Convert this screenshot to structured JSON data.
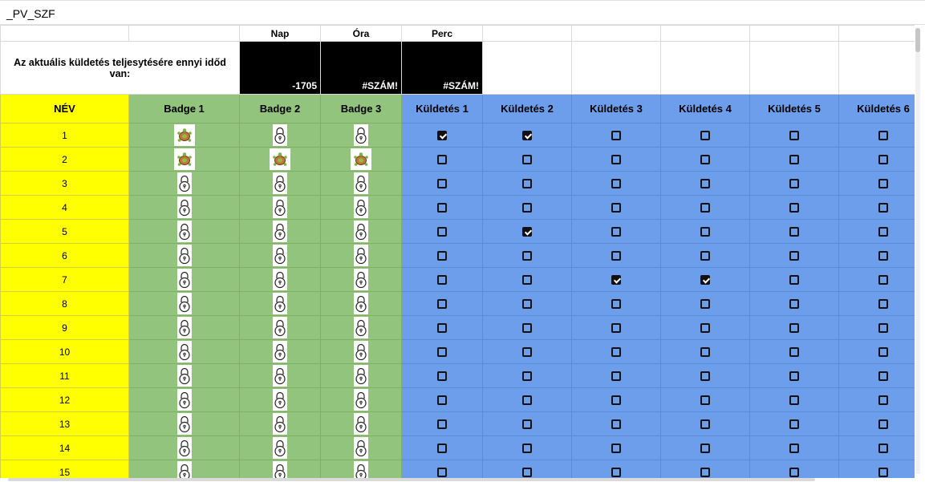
{
  "sheet": {
    "title": "_PV_SZF"
  },
  "time_header": {
    "labels": [
      "Nap",
      "Óra",
      "Perc"
    ]
  },
  "info": {
    "prompt": "Az aktuális küldetés teljesytésére ennyi időd van:",
    "values": [
      "-1705",
      "#SZÁM!",
      "#SZÁM!"
    ]
  },
  "columns": {
    "name": "NÉV",
    "badges": [
      "Badge 1",
      "Badge 2",
      "Badge 3"
    ],
    "missions": [
      "Küldetés 1",
      "Küldetés 2",
      "Küldetés 3",
      "Küldetés 4",
      "Küldetés 5",
      "Küldetés 6"
    ]
  },
  "colors": {
    "name_bg": "#ffff00",
    "badge_bg": "#93c47d",
    "mission_bg": "#6d9eeb",
    "time_bg": "#000000"
  },
  "icons": {
    "earned_badge": "turtle-icon",
    "locked_badge": "padlock-icon"
  },
  "rows": [
    {
      "id": "1",
      "badges": [
        "turtle",
        "locked",
        "locked"
      ],
      "missions": [
        true,
        true,
        false,
        false,
        false,
        false
      ]
    },
    {
      "id": "2",
      "badges": [
        "turtle",
        "turtle",
        "turtle"
      ],
      "missions": [
        false,
        false,
        false,
        false,
        false,
        false
      ]
    },
    {
      "id": "3",
      "badges": [
        "locked",
        "locked",
        "locked"
      ],
      "missions": [
        false,
        false,
        false,
        false,
        false,
        false
      ]
    },
    {
      "id": "4",
      "badges": [
        "locked",
        "locked",
        "locked"
      ],
      "missions": [
        false,
        false,
        false,
        false,
        false,
        false
      ]
    },
    {
      "id": "5",
      "badges": [
        "locked",
        "locked",
        "locked"
      ],
      "missions": [
        false,
        true,
        false,
        false,
        false,
        false
      ]
    },
    {
      "id": "6",
      "badges": [
        "locked",
        "locked",
        "locked"
      ],
      "missions": [
        false,
        false,
        false,
        false,
        false,
        false
      ]
    },
    {
      "id": "7",
      "badges": [
        "locked",
        "locked",
        "locked"
      ],
      "missions": [
        false,
        false,
        true,
        true,
        false,
        false
      ]
    },
    {
      "id": "8",
      "badges": [
        "locked",
        "locked",
        "locked"
      ],
      "missions": [
        false,
        false,
        false,
        false,
        false,
        false
      ]
    },
    {
      "id": "9",
      "badges": [
        "locked",
        "locked",
        "locked"
      ],
      "missions": [
        false,
        false,
        false,
        false,
        false,
        false
      ]
    },
    {
      "id": "10",
      "badges": [
        "locked",
        "locked",
        "locked"
      ],
      "missions": [
        false,
        false,
        false,
        false,
        false,
        false
      ]
    },
    {
      "id": "11",
      "badges": [
        "locked",
        "locked",
        "locked"
      ],
      "missions": [
        false,
        false,
        false,
        false,
        false,
        false
      ]
    },
    {
      "id": "12",
      "badges": [
        "locked",
        "locked",
        "locked"
      ],
      "missions": [
        false,
        false,
        false,
        false,
        false,
        false
      ]
    },
    {
      "id": "13",
      "badges": [
        "locked",
        "locked",
        "locked"
      ],
      "missions": [
        false,
        false,
        false,
        false,
        false,
        false
      ]
    },
    {
      "id": "14",
      "badges": [
        "locked",
        "locked",
        "locked"
      ],
      "missions": [
        false,
        false,
        false,
        false,
        false,
        false
      ]
    },
    {
      "id": "15",
      "badges": [
        "locked",
        "locked",
        "locked"
      ],
      "missions": [
        false,
        false,
        false,
        false,
        false,
        false
      ]
    }
  ]
}
